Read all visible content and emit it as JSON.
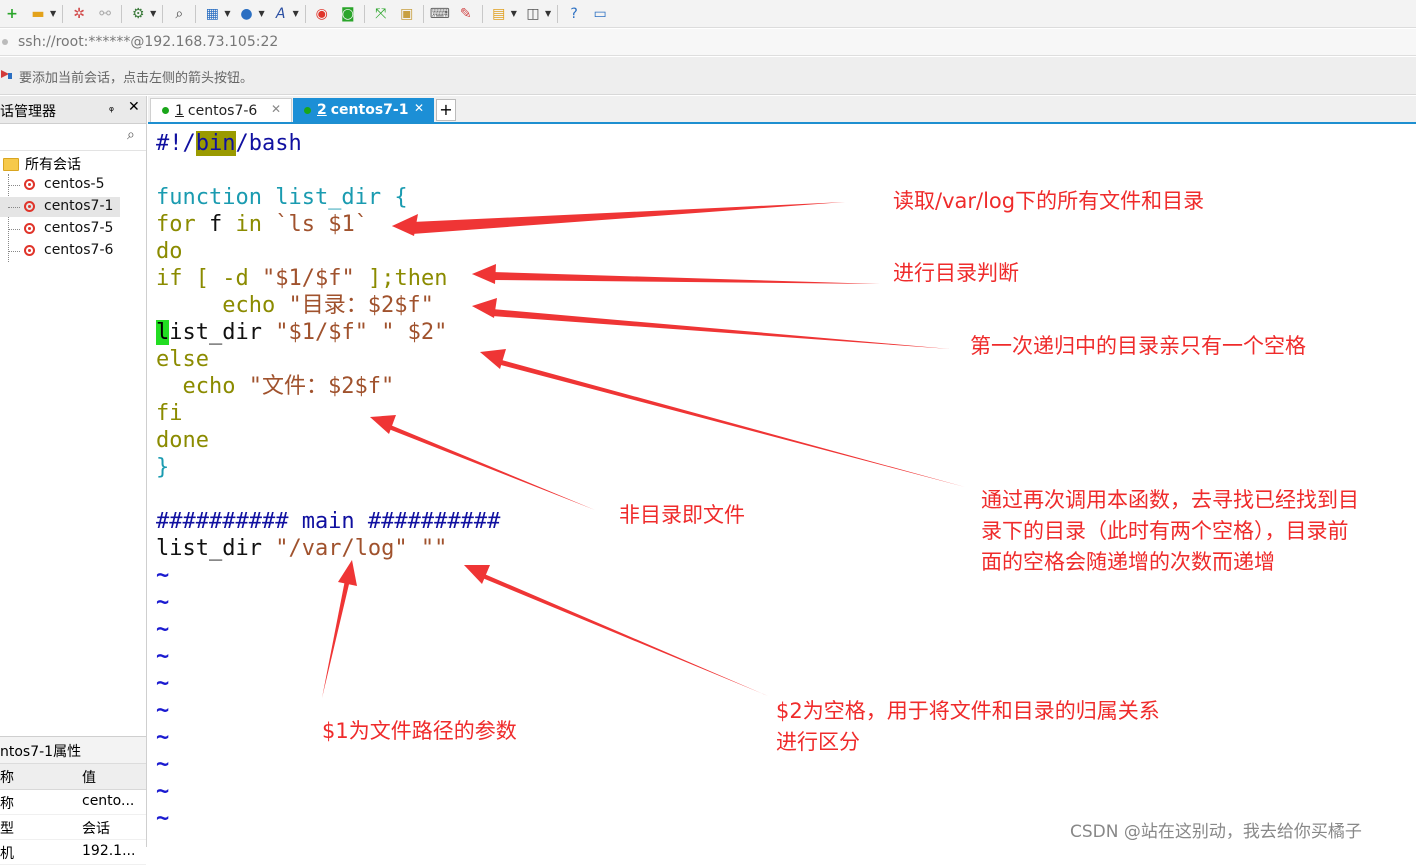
{
  "toolbar": {
    "icons": [
      "new-session-icon",
      "open-folder-icon",
      "reconnect-icon",
      "disconnect-icon",
      "settings-icon",
      "find-icon",
      "transfer-icon",
      "globe-icon",
      "font-icon",
      "xshell-icon",
      "xftp-icon",
      "fullscreen-icon",
      "lock-icon",
      "keyboard-icon",
      "compose-icon",
      "new-tab-icon",
      "layout-icon",
      "help-icon",
      "chat-icon"
    ]
  },
  "address": {
    "text": "ssh://root:******@192.168.73.105:22"
  },
  "hint": {
    "text": "要添加当前会话，点击左侧的箭头按钮。"
  },
  "sidebar": {
    "title": "话管理器",
    "pin": "ᵩ",
    "close": "✕",
    "root": "所有会话",
    "items": [
      {
        "label": "centos-5"
      },
      {
        "label": "centos7-1"
      },
      {
        "label": "centos7-5"
      },
      {
        "label": "centos7-6"
      }
    ]
  },
  "properties": {
    "title": "ntos7-1属性",
    "header_name": "称",
    "header_value": "值",
    "rows": [
      {
        "name": "称",
        "value": "cento..."
      },
      {
        "name": "型",
        "value": "会话"
      },
      {
        "name": "机",
        "value": "192.1..."
      }
    ]
  },
  "tabs": [
    {
      "num": "1",
      "label": "centos7-6",
      "close": "✕"
    },
    {
      "num": "2",
      "label": "centos7-1",
      "close": "✕"
    }
  ],
  "tab_add": "+",
  "code": {
    "l1_a": "#!/",
    "l1_b": "bin",
    "l1_c": "/bash",
    "l3_a": "function list_dir {",
    "l4_a": "for",
    "l4_b": " f ",
    "l4_c": "in",
    "l4_d": " `ls $1`",
    "l5": "do",
    "l6_a": "if",
    "l6_b": " [ -d ",
    "l6_c": "\"$1/$f\"",
    "l6_d": " ];",
    "l6_e": "then",
    "l7_a": "     echo ",
    "l7_b": "\"目录：$2$f\"",
    "l8_a": "l",
    "l8_b": "ist_dir ",
    "l8_c": "\"$1/$f\"",
    "l8_d": " ",
    "l8_e": "\" $2\"",
    "l9": "else",
    "l10_a": "  echo ",
    "l10_b": "\"文件：$2$f\"",
    "l11": "fi",
    "l12": "done",
    "l13": "}",
    "l15": "########## main ##########",
    "l16_a": "list_dir ",
    "l16_b": "\"/var/log\"",
    "l16_c": " ",
    "l16_d": "\"\"",
    "tilde": "~"
  },
  "annotations": {
    "a1": "读取/var/log下的所有文件和目录",
    "a2": "进行目录判断",
    "a3": "第一次递归中的目录亲只有一个空格",
    "a4": "通过再次调用本函数，去寻找已经找到目\n录下的目录（此时有两个空格），目录前\n面的空格会随递增的次数而递增",
    "a5": "非目录即文件",
    "a6": "$1为文件路径的参数",
    "a7": "$2为空格，用于将文件和目录的归属关系\n进行区分"
  },
  "watermark": "CSDN @站在这别动，我去给你买橘子",
  "colors": {
    "annotation": "#ef2b2b",
    "tab_active": "#1c8fd6",
    "cursor": "#22dd22"
  }
}
